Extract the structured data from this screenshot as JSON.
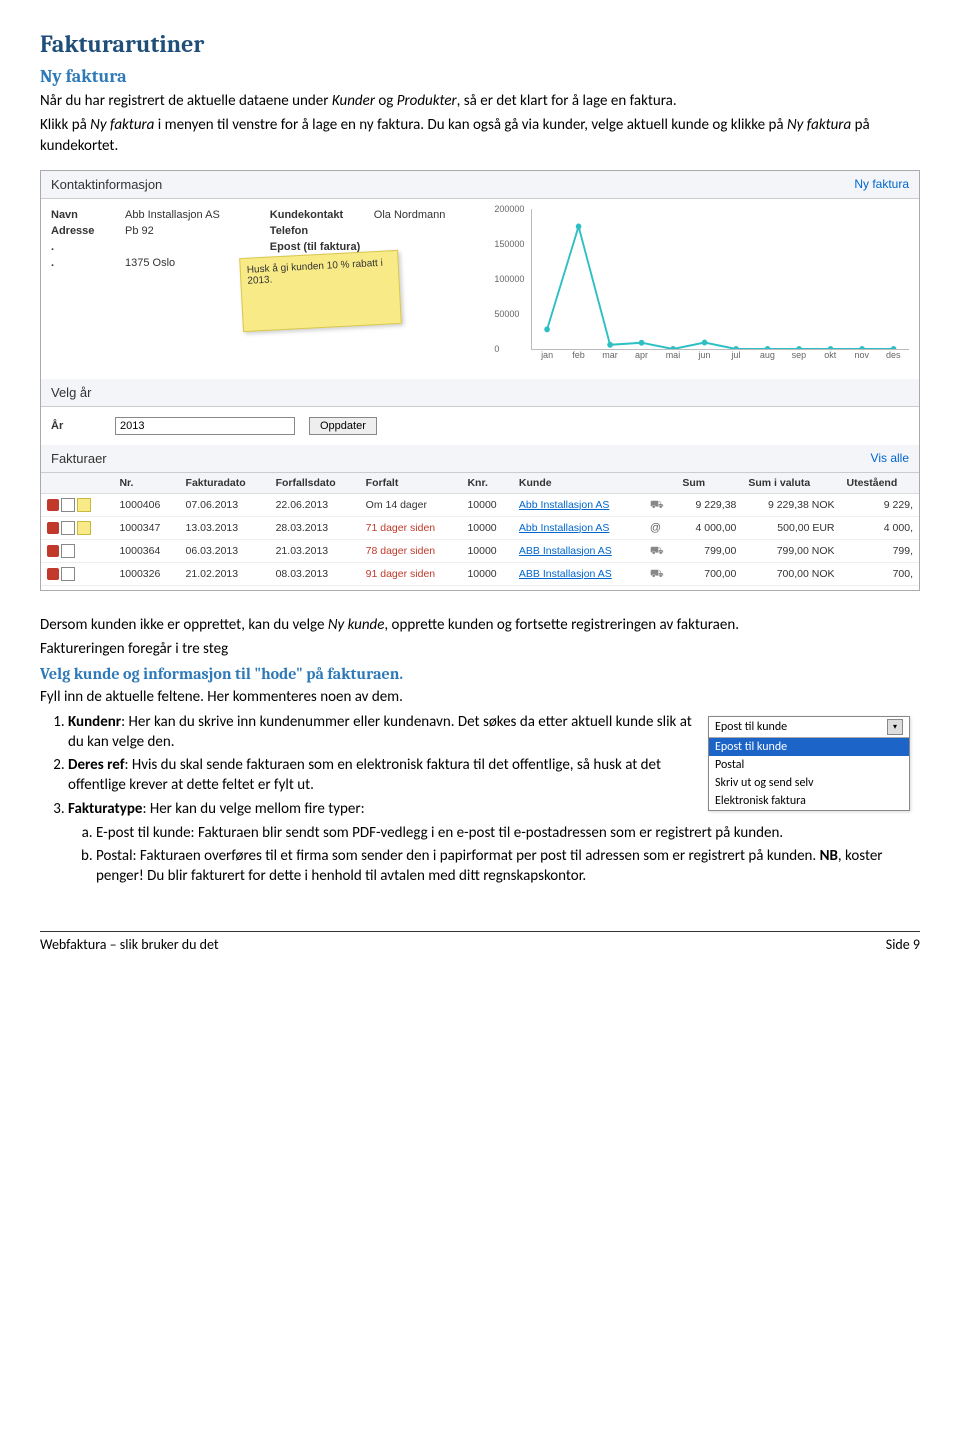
{
  "doc": {
    "h1": "Fakturarutiner",
    "h2": "Ny faktura",
    "p1a": "Når du har registrert de aktuelle dataene under ",
    "p1b": " og ",
    "p1c": ", så er det klart for å lage en faktura.",
    "i1": "Kunder",
    "i2": "Produkter",
    "p2a": "Klikk på ",
    "p2b": " i menyen til venstre for å lage en ny faktura. Du kan også gå via kunder, velge aktuell kunde og klikke på ",
    "p2c": " på kundekortet.",
    "i3": "Ny faktura",
    "i4": "Ny faktura",
    "p3a": "Dersom kunden ikke er opprettet, kan du velge ",
    "p3b": ", opprette kunden og fortsette registreringen av fakturaen.",
    "i5": "Ny kunde",
    "p4": "Faktureringen foregår i tre steg",
    "h3": "Velg kunde og informasjon til \"hode\" på fakturaen.",
    "p5": "Fyll inn de aktuelle feltene. Her kommenteres noen av dem.",
    "li1b": "Kundenr",
    "li1t": ": Her kan du skrive inn kundenummer eller kundenavn. Det søkes da etter aktuell kunde slik at du kan velge den.",
    "li2b": "Deres ref",
    "li2t": ": Hvis du skal sende fakturaen som en elektronisk faktura til det offentlige, så husk at det offentlige krever at dette feltet er fylt ut.",
    "li3b": "Fakturatype",
    "li3t": ": Her kan du velge mellom fire typer:",
    "li3a": "E-post til kunde: Fakturaen blir sendt som PDF-vedlegg i en e-post til e-postadressen som er registrert på kunden.",
    "li3b2a": "Postal: Fakturaen overføres til et firma som sender den i papirformat per post til adressen som er registrert på kunden. ",
    "li3b2b": "NB",
    "li3b2c": ", koster penger! Du blir fakturert for dette i henhold til avtalen med ditt regnskapskontor.",
    "footer_left": "Webfaktura – slik bruker du det",
    "footer_right": "Side 9"
  },
  "dropdown": {
    "selected": "Epost til kunde",
    "options": [
      "Epost til kunde",
      "Postal",
      "Skriv ut og send selv",
      "Elektronisk faktura"
    ]
  },
  "shot": {
    "panel1_title": "Kontaktinformasjon",
    "panel1_link": "Ny faktura",
    "navn_lbl": "Navn",
    "navn_val": "Abb Installasjon AS",
    "adr_lbl": "Adresse",
    "adr_val": "Pb 92",
    "dot": ".",
    "city": "1375 Oslo",
    "kk_lbl": "Kundekontakt",
    "kk_val": "Ola Nordmann",
    "tel_lbl": "Telefon",
    "ep_lbl": "Epost (til faktura)",
    "sticky": "Husk å gi kunden 10 % rabatt i 2013.",
    "panel2_title": "Velg år",
    "year_lbl": "År",
    "year_val": "2013",
    "year_btn": "Oppdater",
    "panel3_title": "Fakturaer",
    "panel3_link": "Vis alle",
    "th": [
      "",
      "Nr.",
      "Fakturadato",
      "Forfallsdato",
      "Forfalt",
      "Knr.",
      "Kunde",
      "",
      "Sum",
      "Sum i valuta",
      "Uteståend"
    ],
    "rows": [
      {
        "icons": [
          "pdf",
          "page",
          "note"
        ],
        "nr": "1000406",
        "fd": "07.06.2013",
        "ff": "22.06.2013",
        "forf": "Om 14 dager",
        "forf_red": false,
        "knr": "10000",
        "kunde": "Abb Installasjon AS",
        "it": "cart",
        "sum": "9 229,38",
        "sv": "9 229,38 NOK",
        "ut": "9 229,"
      },
      {
        "icons": [
          "pdf",
          "page",
          "note"
        ],
        "nr": "1000347",
        "fd": "13.03.2013",
        "ff": "28.03.2013",
        "forf": "71 dager siden",
        "forf_red": true,
        "knr": "10000",
        "kunde": "Abb Installasjon AS",
        "it": "at",
        "sum": "4 000,00",
        "sv": "500,00 EUR",
        "ut": "4 000,"
      },
      {
        "icons": [
          "pdf",
          "page"
        ],
        "nr": "1000364",
        "fd": "06.03.2013",
        "ff": "21.03.2013",
        "forf": "78 dager siden",
        "forf_red": true,
        "knr": "10000",
        "kunde": "ABB Installasjon AS",
        "it": "cart",
        "sum": "799,00",
        "sv": "799,00 NOK",
        "ut": "799,"
      },
      {
        "icons": [
          "pdf",
          "page"
        ],
        "nr": "1000326",
        "fd": "21.02.2013",
        "ff": "08.03.2013",
        "forf": "91 dager siden",
        "forf_red": true,
        "knr": "10000",
        "kunde": "ABB Installasjon AS",
        "it": "cart",
        "sum": "700,00",
        "sv": "700,00 NOK",
        "ut": "700,"
      }
    ]
  },
  "chart_data": {
    "type": "line",
    "categories": [
      "jan",
      "feb",
      "mar",
      "apr",
      "mai",
      "jun",
      "jul",
      "aug",
      "sep",
      "okt",
      "nov",
      "des"
    ],
    "values": [
      28000,
      175000,
      6000,
      9000,
      0,
      9200,
      0,
      0,
      0,
      0,
      0,
      0
    ],
    "ylim": [
      0,
      200000
    ],
    "yticks": [
      0,
      50000,
      100000,
      150000,
      200000
    ],
    "title": "",
    "xlabel": "",
    "ylabel": ""
  }
}
